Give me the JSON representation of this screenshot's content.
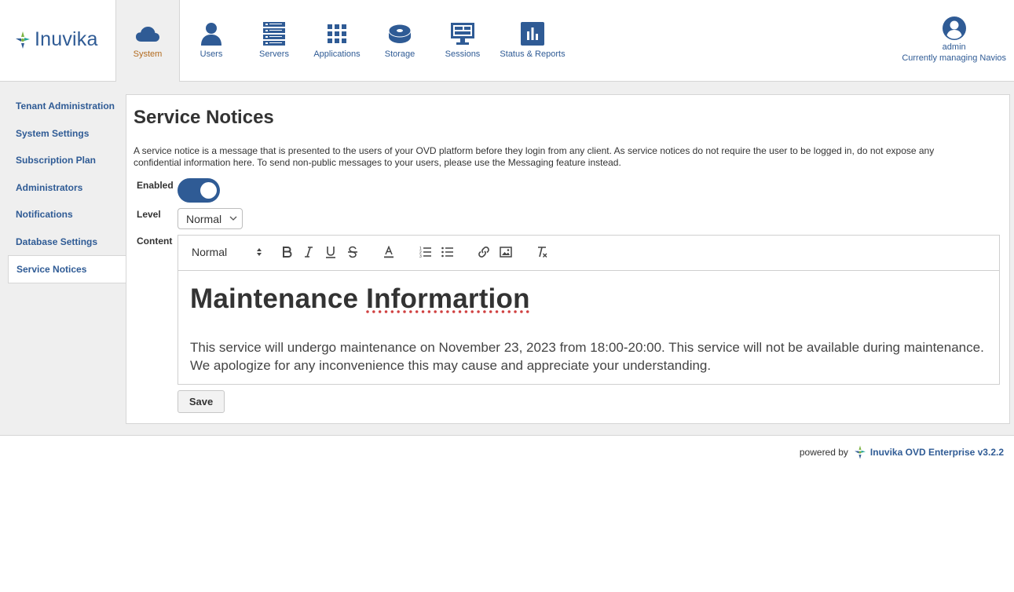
{
  "header": {
    "logo_text": "Inuvika",
    "nav": [
      {
        "label": "System",
        "icon": "cloud-icon"
      },
      {
        "label": "Users",
        "icon": "user-icon"
      },
      {
        "label": "Servers",
        "icon": "server-icon"
      },
      {
        "label": "Applications",
        "icon": "grid-icon"
      },
      {
        "label": "Storage",
        "icon": "disk-icon"
      },
      {
        "label": "Sessions",
        "icon": "monitor-icon"
      },
      {
        "label": "Status & Reports",
        "icon": "bar-chart-icon"
      }
    ],
    "user_name": "admin",
    "managing": "Currently managing Navios"
  },
  "sidebar": {
    "items": [
      {
        "label": "Tenant Administration"
      },
      {
        "label": "System Settings"
      },
      {
        "label": "Subscription Plan"
      },
      {
        "label": "Administrators"
      },
      {
        "label": "Notifications"
      },
      {
        "label": "Database Settings"
      },
      {
        "label": "Service Notices"
      }
    ]
  },
  "main": {
    "title": "Service Notices",
    "description": "A service notice is a message that is presented to the users of your OVD platform before they login from any client. As service notices do not require the user to be logged in, do not expose any confidential information here. To send non-public messages to your users, please use the Messaging feature instead.",
    "enabled_label": "Enabled",
    "enabled": true,
    "level_label": "Level",
    "level_value": "Normal",
    "content_label": "Content",
    "toolbar_format": "Normal",
    "heading_word1": "Maintenance",
    "heading_word2": "Informartion",
    "body_text": "This service will undergo maintenance on November 23, 2023 from 18:00-20:00. This service will not be available during maintenance. We apologize for any inconvenience this may cause and appreciate your understanding.",
    "save_label": "Save"
  },
  "footer": {
    "powered_by": "powered by",
    "brand": "Inuvika OVD Enterprise v3.2.2"
  },
  "colors": {
    "brand_blue": "#2f5b95",
    "active_orange": "#b26a1e",
    "panel_bg": "#efefef"
  }
}
